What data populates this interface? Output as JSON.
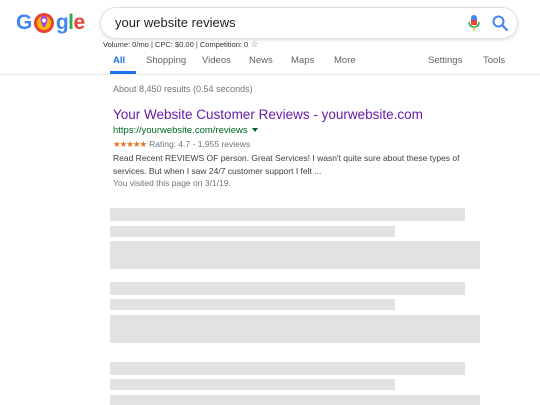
{
  "logo": {
    "g": "G",
    "rest_g": "g",
    "rest_l": "l",
    "rest_e": "e"
  },
  "search": {
    "query": "your website reviews"
  },
  "volume_line": "Volume: 0/mo | CPC: $0.00 | Competition: 0",
  "tabs": [
    {
      "label": "All",
      "active": true
    },
    {
      "label": "Shopping"
    },
    {
      "label": "Videos"
    },
    {
      "label": "News"
    },
    {
      "label": "Maps"
    },
    {
      "label": "More"
    },
    {
      "label": "Settings"
    },
    {
      "label": "Tools"
    }
  ],
  "stats": "About 8,450 results (0.54 seconds)",
  "result": {
    "title": "Your Website Customer Reviews - yourwebsite.com",
    "url": "https://yourwebsite.com/reviews",
    "stars": "★★★★★",
    "rating_text": "Rating: 4.7 - 1,955 reviews",
    "snippet_line1": "Read Recent REVIEWS OF person. Great Services! I wasn't quite sure about these types of",
    "snippet_line2": "services. But when I saw 24/7 customer support I felt ...",
    "visited": "You visited this page on 3/1/19."
  },
  "colors": {
    "link_visited": "#681da8",
    "url_green": "#006621",
    "tab_active": "#1a73e8",
    "star_orange": "#e7711b",
    "placeholder": "#e2e2e2"
  }
}
